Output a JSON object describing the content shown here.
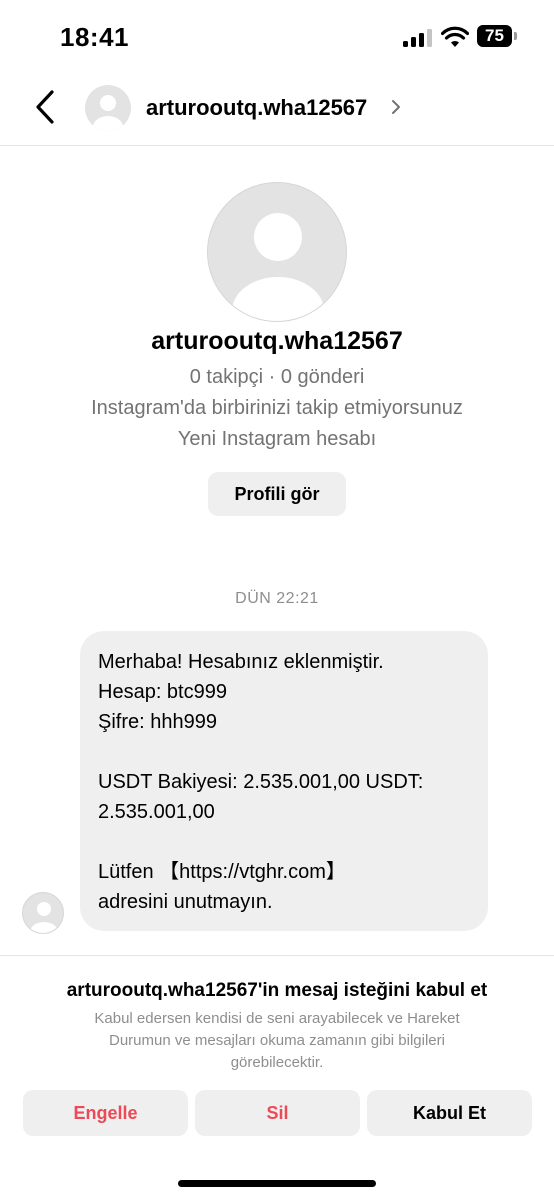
{
  "status_bar": {
    "time": "18:41",
    "battery": "75",
    "icons": [
      "signal-icon",
      "wifi-icon",
      "battery-icon"
    ]
  },
  "header": {
    "username": "arturooutq.wha12567",
    "icons": [
      "back-arrow-icon",
      "avatar-placeholder-icon",
      "chevron-right-icon"
    ]
  },
  "profile": {
    "username": "arturooutq.wha12567",
    "stats": "0 takipçi · 0 gönderi",
    "follow_status": "Instagram'da birbirinizi takip etmiyorsunuz",
    "account_note": "Yeni Instagram hesabı",
    "view_profile_label": "Profili gör"
  },
  "conversation": {
    "timestamp": "DÜN 22:21",
    "message_lines": [
      "Merhaba! Hesabınız eklenmiştir.",
      "Hesap: btc999",
      "Şifre: hhh999",
      "",
      "USDT Bakiyesi: 2.535.001,00 USDT:",
      "2.535.001,00",
      "",
      "Lütfen 【https://vtghr.com】",
      "adresini unutmayın."
    ]
  },
  "request": {
    "title": "arturooutq.wha12567'in mesaj isteğini kabul et",
    "description_lines": [
      "Kabul edersen kendisi de seni arayabilecek ve Hareket",
      "Durumun ve mesajları okuma zamanın gibi bilgileri",
      "görebilecektir."
    ],
    "block_label": "Engelle",
    "delete_label": "Sil",
    "accept_label": "Kabul Et"
  },
  "colors": {
    "destructive": "#ed4956",
    "secondary_text": "#737373",
    "bubble_background": "#efefef",
    "button_background": "#efefef"
  }
}
